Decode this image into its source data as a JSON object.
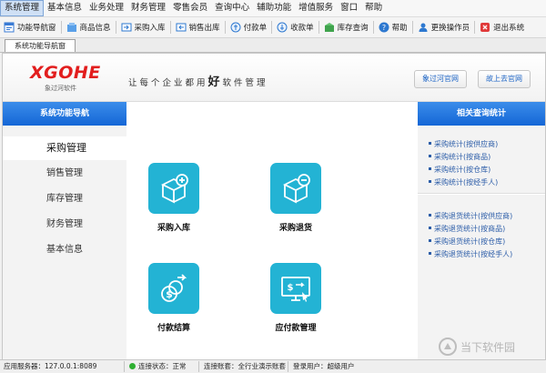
{
  "menu": [
    "系统管理",
    "基本信息",
    "业务处理",
    "财务管理",
    "零售会员",
    "查询中心",
    "辅助功能",
    "增值服务",
    "窗口",
    "帮助"
  ],
  "toolbar": [
    {
      "label": "功能导航窗",
      "icon": "navigation-window-icon"
    },
    {
      "label": "商品信息",
      "icon": "product-info-icon"
    },
    {
      "label": "采购入库",
      "icon": "purchase-inbound-icon"
    },
    {
      "label": "销售出库",
      "icon": "sales-outbound-icon"
    },
    {
      "label": "付款单",
      "icon": "payment-order-icon"
    },
    {
      "label": "收款单",
      "icon": "receipt-order-icon"
    },
    {
      "label": "库存查询",
      "icon": "inventory-query-icon"
    },
    {
      "label": "帮助",
      "icon": "help-icon"
    },
    {
      "label": "更换操作员",
      "icon": "switch-operator-icon"
    },
    {
      "label": "退出系统",
      "icon": "exit-icon"
    }
  ],
  "tab": "系统功能导航窗",
  "header": {
    "logo": "XGOHE",
    "logo_sub": "象过河软件",
    "slogan_pre": "让每个企业都用",
    "slogan_hl": "好",
    "slogan_post": "软件管理",
    "btn_official": "象过河官网",
    "btn_store": "故上去官网"
  },
  "left_panel": {
    "title": "系统功能导航",
    "items": [
      "采购管理",
      "销售管理",
      "库存管理",
      "财务管理",
      "基本信息"
    ]
  },
  "tiles": [
    {
      "label": "采购入库",
      "icon": "box-add-icon"
    },
    {
      "label": "采购退货",
      "icon": "box-minus-icon"
    },
    {
      "label": "付款结算",
      "icon": "coin-settlement-icon"
    },
    {
      "label": "应付款管理",
      "icon": "monitor-payment-icon"
    }
  ],
  "right_panel": {
    "title": "相关查询统计",
    "group1": [
      "采购统计(按供应商)",
      "采购统计(按商品)",
      "采购统计(按仓库)",
      "采购统计(按经手人)"
    ],
    "group2": [
      "采购退货统计(按供应商)",
      "采购退货统计(按商品)",
      "采购退货统计(按仓库)",
      "采购退货统计(按经手人)"
    ]
  },
  "status": {
    "server": "应用服务器：127.0.0.1:8089",
    "conn": "连接状态：正常",
    "account": "连接账套：全行业演示账套",
    "user": "登录用户：超级用户"
  },
  "watermark": "当下软件园",
  "colors": {
    "accent": "#1466d6",
    "tile": "#23b3d4",
    "logo": "#e21e1e"
  }
}
